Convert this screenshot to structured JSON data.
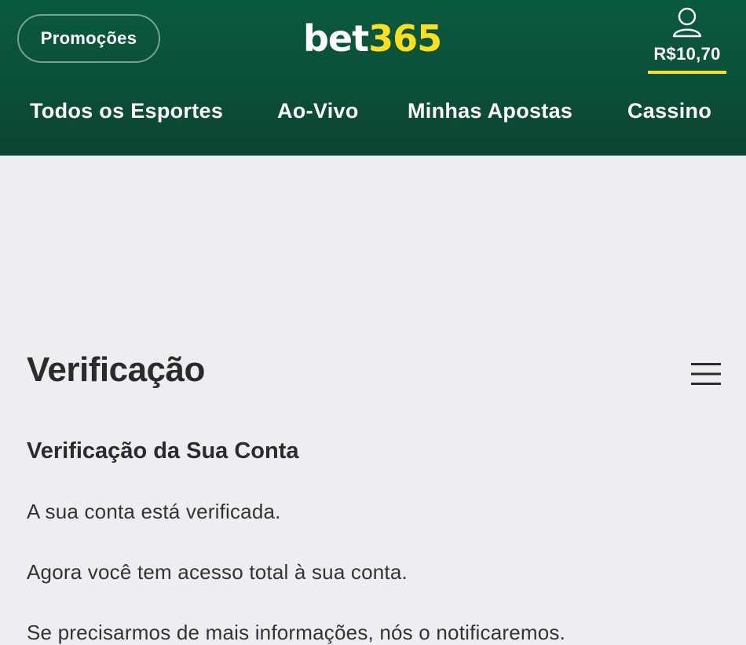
{
  "header": {
    "promo_label": "Promoções",
    "logo_white": "bet",
    "logo_yellow": "365",
    "balance": "R$10,70",
    "user_icon": "user-icon",
    "colors": {
      "brand_green": "#0b5038",
      "accent_yellow": "#ffdf1b"
    }
  },
  "nav": {
    "items": [
      {
        "label": "Todos os Esportes"
      },
      {
        "label": "Ao-Vivo"
      },
      {
        "label": "Minhas Apostas"
      },
      {
        "label": "Cassino"
      }
    ]
  },
  "page": {
    "title": "Verificação",
    "menu_icon": "hamburger-menu-icon",
    "section_title": "Verificação da Sua Conta",
    "paragraphs": [
      "A sua conta está verificada.",
      "Agora você tem acesso total à sua conta.",
      "Se precisarmos de mais informações, nós o notificaremos."
    ]
  }
}
